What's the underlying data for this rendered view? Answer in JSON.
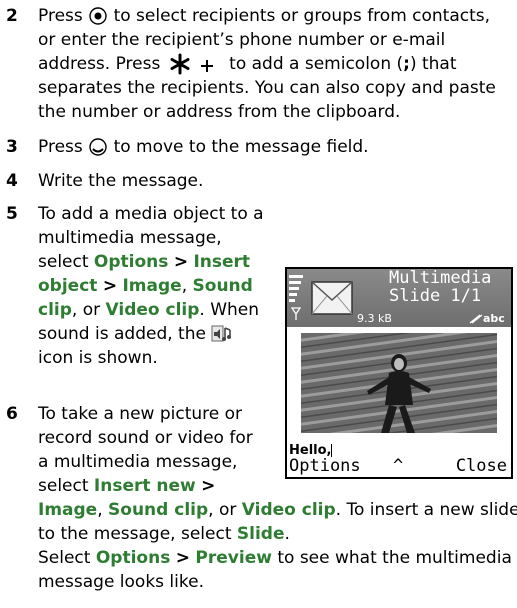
{
  "steps": [
    {
      "num": "2",
      "parts": {
        "a": "Press",
        "b": "to select recipients or groups from contacts,",
        "c": "or enter the recipient’s phone number or e-mail",
        "d": "address. Press",
        "e": "to add a semicolon (",
        "f": ";",
        "g": ") that",
        "h": "separates the recipients. You can also copy and paste",
        "i": "the number or address from the clipboard."
      }
    },
    {
      "num": "3",
      "parts": {
        "a": "Press",
        "b": "to move to the message field."
      }
    },
    {
      "num": "4",
      "parts": {
        "a": "Write the message."
      }
    },
    {
      "num": "5",
      "parts": {
        "l1": "To add a media object to a",
        "l2": "multimedia message,",
        "l3a": "select",
        "l3b": "Options",
        "l3c": ">",
        "l3d": "Insert",
        "l4a": "object",
        "l4b": ">",
        "l4c": "Image",
        "l4d": ",",
        "l4e": "Sound",
        "l5a": "clip",
        "l5b": ", or",
        "l5c": "Video clip",
        "l5d": ". When",
        "l6a": "sound is added, the",
        "l7": "icon is shown."
      }
    },
    {
      "num": "6",
      "parts": {
        "l1": "To take a new picture or",
        "l2": "record sound or video for",
        "l3": "a multimedia message,",
        "l4a": "select",
        "l4b": "Insert new",
        "l4c": ">",
        "l5a": "Image",
        "l5b": ",",
        "l5c": "Sound clip",
        "l5d": ", or",
        "l5e": "Video clip",
        "l5f": ". To insert a new slide",
        "l6a": "to the message, select",
        "l6b": "Slide",
        "l6c": ".",
        "l7a": "Select",
        "l7b": "Options",
        "l7c": ">",
        "l7d": "Preview",
        "l7e": "to see what the multimedia",
        "l8": "message looks like."
      }
    }
  ],
  "phone": {
    "title1": "Multimedia",
    "title2": "Slide 1/1",
    "size": "9.3 kB",
    "input_mode": "abc",
    "message": "Hello,",
    "left_soft": "Options",
    "center_soft": "^",
    "right_soft": "Close"
  },
  "icons": [
    "joystick-press-icon",
    "star-plus-key-icon",
    "joystick-down-icon",
    "sound-clip-icon",
    "message-envelope-icon",
    "signal-icon"
  ],
  "colors": {
    "keyword": "#2e7d32"
  }
}
